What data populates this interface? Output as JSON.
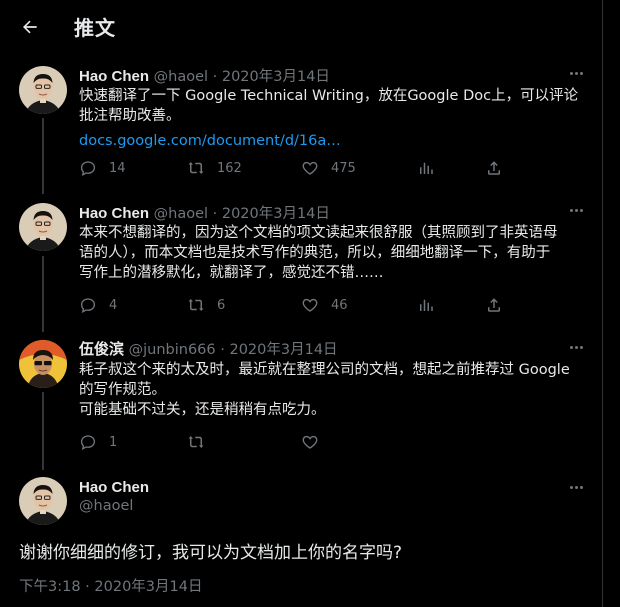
{
  "header": {
    "title": "推文",
    "back_icon": "arrow-left-icon"
  },
  "colors": {
    "background": "#000000",
    "text": "#e7e9ea",
    "muted": "#71767b",
    "link": "#1d9bf0",
    "thread_line": "#333639"
  },
  "tweets": [
    {
      "name": "Hao Chen",
      "handle": "@haoel",
      "dot": "·",
      "date": "2020年3月14日",
      "lines": [
        "快速翻译了一下 Google Technical Writing，放在Google Doc上，可以评论",
        "批注帮助改善。"
      ],
      "link": "docs.google.com/document/d/16a…",
      "replies": "14",
      "retweets": "162",
      "likes": "475"
    },
    {
      "name": "Hao Chen",
      "handle": "@haoel",
      "dot": "·",
      "date": "2020年3月14日",
      "lines": [
        "本来不想翻译的，因为这个文档的项文读起来很舒服（其照顾到了非英语母",
        "语的人），而本文档也是技术写作的典范，所以，细细地翻译一下，有助于",
        "写作上的潜移默化，就翻译了，感觉还不错……"
      ],
      "replies": "4",
      "retweets": "6",
      "likes": "46"
    },
    {
      "name": "伍俊滨",
      "handle": "@junbin666",
      "dot": "·",
      "date": "2020年3月14日",
      "lines": [
        "耗子叔这个来的太及时，最近就在整理公司的文档，想起之前推荐过 Google",
        "的写作规范。",
        "可能基础不过关，还是稍稍有点吃力。"
      ],
      "replies": "1",
      "retweets": "",
      "likes": ""
    }
  ],
  "main_tweet": {
    "name": "Hao Chen",
    "handle": "@haoel",
    "text": "谢谢你细细的修订，我可以为文档加上你的名字吗?",
    "time": "下午3:18 · 2020年3月14日"
  },
  "icons": {
    "reply": "reply-icon",
    "retweet": "retweet-icon",
    "like": "heart-icon",
    "views": "analytics-icon",
    "share": "share-icon",
    "more": "more-icon"
  }
}
